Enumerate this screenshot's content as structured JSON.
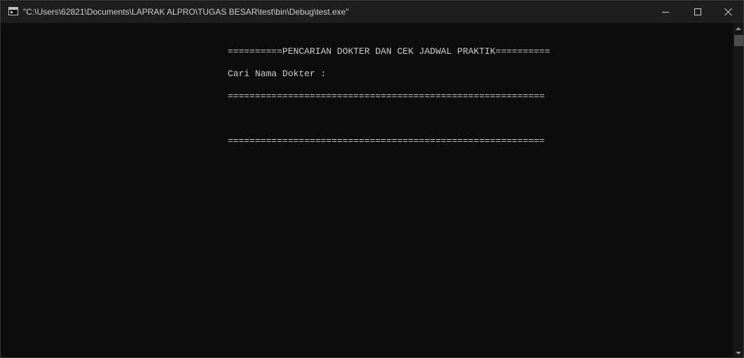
{
  "window": {
    "title": "\"C:\\Users\\62821\\Documents\\LAPRAK ALPRO\\TUGAS BESAR\\test\\bin\\Debug\\test.exe\"",
    "icon": "console-app-icon",
    "controls": {
      "minimize": "minimize-icon",
      "maximize": "maximize-icon",
      "close": "close-icon"
    }
  },
  "console": {
    "lines": [
      "==========PENCARIAN DOKTER DAN CEK JADWAL PRAKTIK==========",
      "Cari Nama Dokter : ",
      "==========================================================",
      "=========================================================="
    ]
  },
  "colors": {
    "background": "#0c0c0c",
    "text": "#cccccc",
    "titlebar": "#1f1f1f"
  }
}
